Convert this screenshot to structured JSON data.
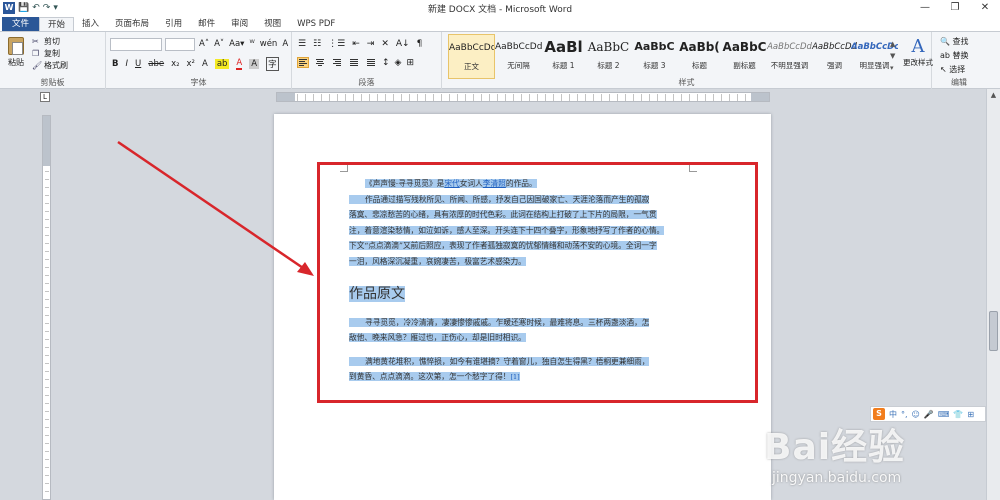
{
  "window": {
    "title": "新建 DOCX 文档 - Microsoft Word",
    "controls": [
      "—",
      "❐",
      "✕"
    ]
  },
  "quick_access": [
    "💾",
    "↶",
    "↷",
    "▾"
  ],
  "tabs": [
    {
      "label": "文件",
      "type": "file"
    },
    {
      "label": "开始",
      "active": true
    },
    {
      "label": "插入"
    },
    {
      "label": "页面布局"
    },
    {
      "label": "引用"
    },
    {
      "label": "邮件"
    },
    {
      "label": "审阅"
    },
    {
      "label": "视图"
    },
    {
      "label": "WPS PDF"
    }
  ],
  "ribbon": {
    "clipboard": {
      "paste": "粘贴",
      "cut": "剪切",
      "copy": "复制",
      "format_painter": "格式刷",
      "group_label": "剪贴板"
    },
    "font": {
      "group_label": "字体",
      "row1": [
        "A˄",
        "A˅",
        "Aa▾",
        "ᵂ",
        "wén",
        "A"
      ],
      "row2": [
        "B",
        "I",
        "U",
        "abe",
        "x₂",
        "x²",
        "A",
        "ab",
        "A",
        "A",
        "字"
      ]
    },
    "paragraph": {
      "group_label": "段落",
      "row1": [
        "☰",
        "☷",
        "⋮☰",
        "⇤",
        "⇥",
        "✕",
        "A↓",
        "¶"
      ]
    },
    "styles": {
      "group_label": "样式",
      "items": [
        {
          "sample": "AaBbCcDd",
          "name": "正文",
          "selected": true
        },
        {
          "sample": "AaBbCcDd",
          "name": "无间隔"
        },
        {
          "sample": "AaBl",
          "name": "标题 1"
        },
        {
          "sample": "AaBbC",
          "name": "标题 2"
        },
        {
          "sample": "AaBbC",
          "name": "标题 3"
        },
        {
          "sample": "AaBb(",
          "name": "标题"
        },
        {
          "sample": "AaBbC",
          "name": "副标题"
        },
        {
          "sample": "AaBbCcDd",
          "name": "不明显强调"
        },
        {
          "sample": "AaBbCcDd",
          "name": "强调"
        },
        {
          "sample": "AaBbCcDc",
          "name": "明显强调"
        }
      ],
      "change_styles": "更改样式"
    },
    "editing": {
      "group_label": "编辑",
      "find": "查找",
      "replace": "替换",
      "select": "选择"
    }
  },
  "document": {
    "p1_parts": [
      "《声声慢·寻寻觅觅》是",
      "宋代",
      "女词人",
      "李清照",
      "的作品。"
    ],
    "p2_lines": [
      "作品通过描写残秋所见、所闻、所感，抒发自己因国破家亡、天涯沦落而产生的孤寂",
      "落寞、悲凉愁苦的心绪，具有浓厚的时代色彩。此词在结构上打破了上下片的局限，一气贯",
      "注，着意渲染愁情，如泣如诉，感人至深。开头连下十四个叠字，形象地抒写了作者的心情。",
      "下文“点点滴滴”又前后照应，表现了作者孤独寂寞的忧郁情绪和动荡不安的心境。全词一字",
      "一泪，风格深沉凝重，哀婉凄苦，极富艺术感染力。"
    ],
    "heading": "作品原文",
    "poem_p1_lines": [
      "寻寻觅觅，冷冷清清，凄凄惨惨戚戚。乍暖还寒时候，最难将息。三杯两盏淡酒，怎",
      "敌他、晚来风急？雁过也，正伤心，却是旧时相识。"
    ],
    "poem_p2_lines": [
      "满地黄花堆积，憔悴损，如今有谁堪摘？守着窗儿，独自怎生得黑？梧桐更兼细雨，",
      "到黄昏、点点滴滴。这次第，怎一个愁字了得！"
    ],
    "citation": "[1]"
  },
  "ime": {
    "logo": "S",
    "items": [
      "中",
      "°,",
      "☺",
      "🎤",
      "⌨",
      "👕",
      "⊞"
    ]
  },
  "watermark": {
    "brand": "Bai经验",
    "url": "jingyan.baidu.com"
  },
  "colors": {
    "word_blue": "#2b579a",
    "selection": "#a8cbee",
    "annotation_red": "#d8262b"
  }
}
